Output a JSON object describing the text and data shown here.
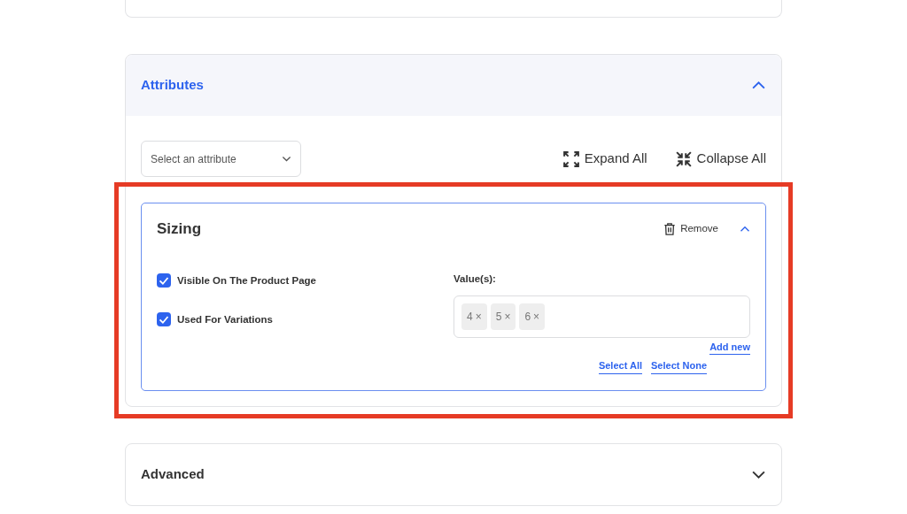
{
  "attributes_panel": {
    "title": "Attributes",
    "expanded": true,
    "select": {
      "placeholder": "Select an attribute"
    },
    "expand_all": "Expand All",
    "collapse_all": "Collapse All",
    "attributes": [
      {
        "name": "Sizing",
        "expanded": true,
        "highlighted": true,
        "remove": "Remove",
        "options": [
          {
            "label": "Visible On The Product Page",
            "checked": true
          },
          {
            "label": "Used For Variations",
            "checked": true
          }
        ],
        "values_label": "Value(s):",
        "values": [
          {
            "label": "4",
            "remove": "×"
          },
          {
            "label": "5",
            "remove": "×"
          },
          {
            "label": "6",
            "remove": "×"
          }
        ],
        "add_new": "Add new",
        "select_all": "Select All",
        "select_none": "Select None"
      }
    ]
  },
  "advanced_panel": {
    "title": "Advanced",
    "expanded": false
  }
}
